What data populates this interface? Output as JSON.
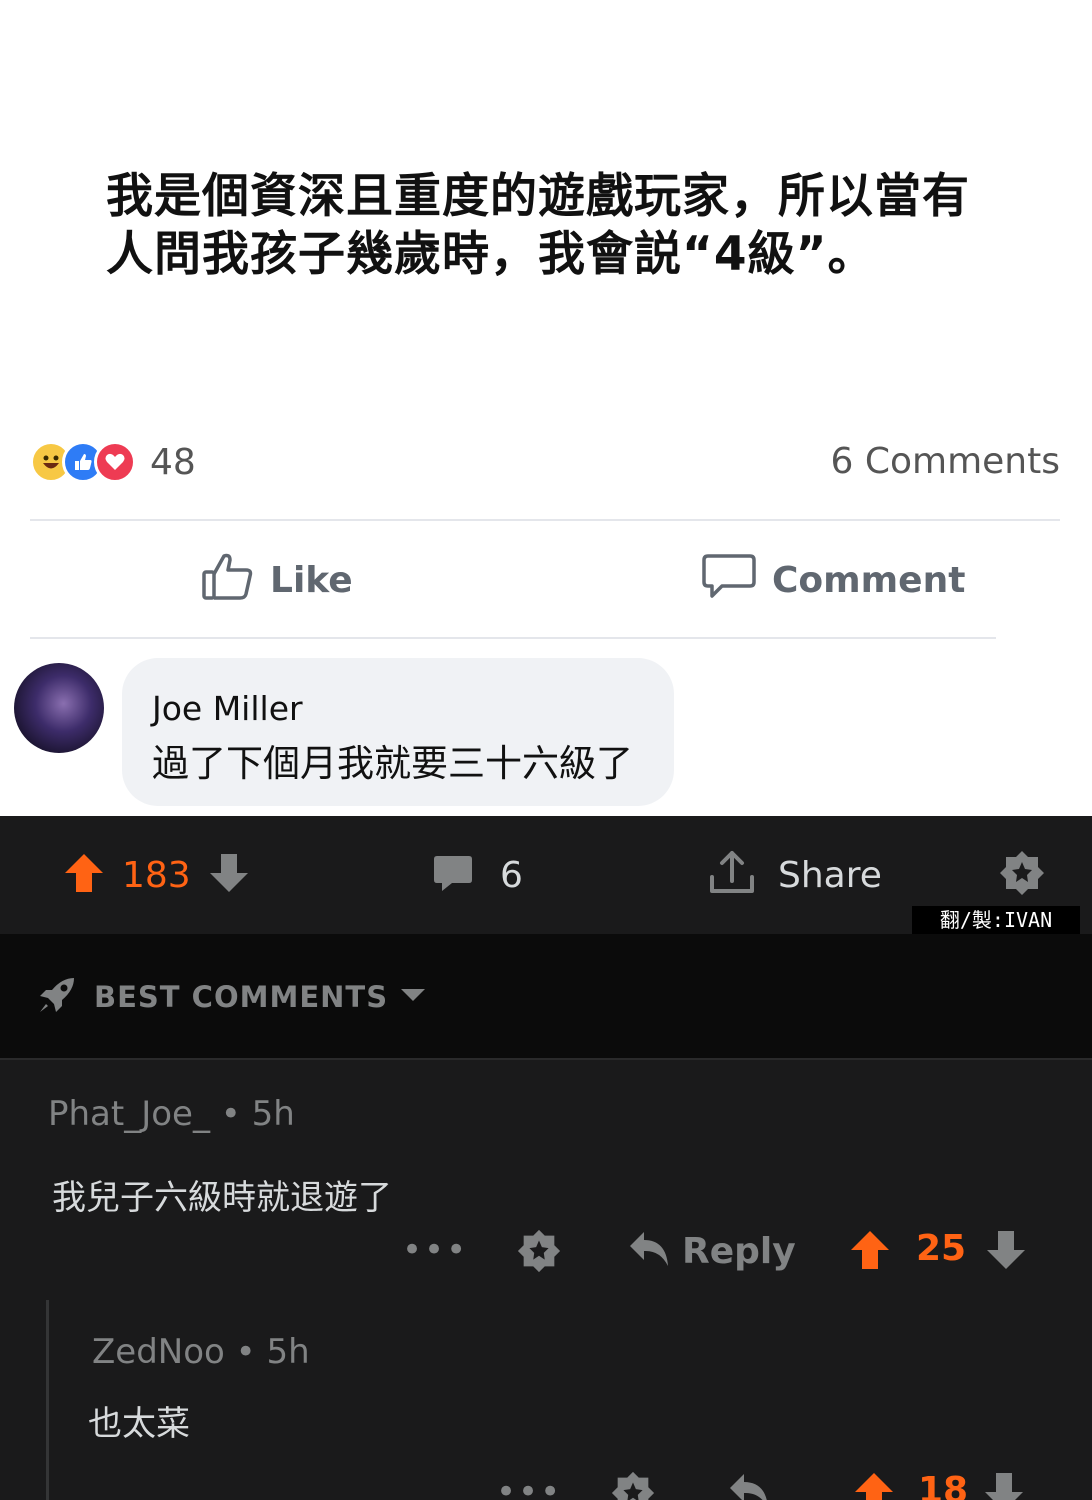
{
  "facebook": {
    "post_text_line1": "我是個資深且重度的遊戲玩家，所以當有",
    "post_text_line2": "人問我孩子幾歲時，我會説“4級”。",
    "reaction_count": "48",
    "comments_count": "6 Comments",
    "like_label": "Like",
    "comment_label": "Comment",
    "comment": {
      "author": "Joe Miller",
      "text": "過了下個月我就要三十六級了"
    }
  },
  "reddit": {
    "upvotes": "183",
    "comment_count": "6",
    "share_label": "Share",
    "credit": "翻/製:IVAN MADE",
    "best_comments_label": "BEST COMMENTS",
    "comments": [
      {
        "author_meta": "Phat_Joe_ • 5h",
        "text": "我兒子六級時就退遊了",
        "dots": "•••",
        "reply_label": "Reply",
        "votes": "25"
      },
      {
        "author_meta": "ZedNoo • 5h",
        "text": "也太菜",
        "dots": "•••",
        "votes": "18"
      }
    ]
  },
  "colors": {
    "reddit_orange": "#ff6314",
    "reddit_bg": "#1a1a1b",
    "fb_bubble": "#f0f2f5",
    "fb_like_blue": "#2e7cf6",
    "fb_love_red": "#ee3b53",
    "fb_haha_yellow": "#f7c844"
  }
}
